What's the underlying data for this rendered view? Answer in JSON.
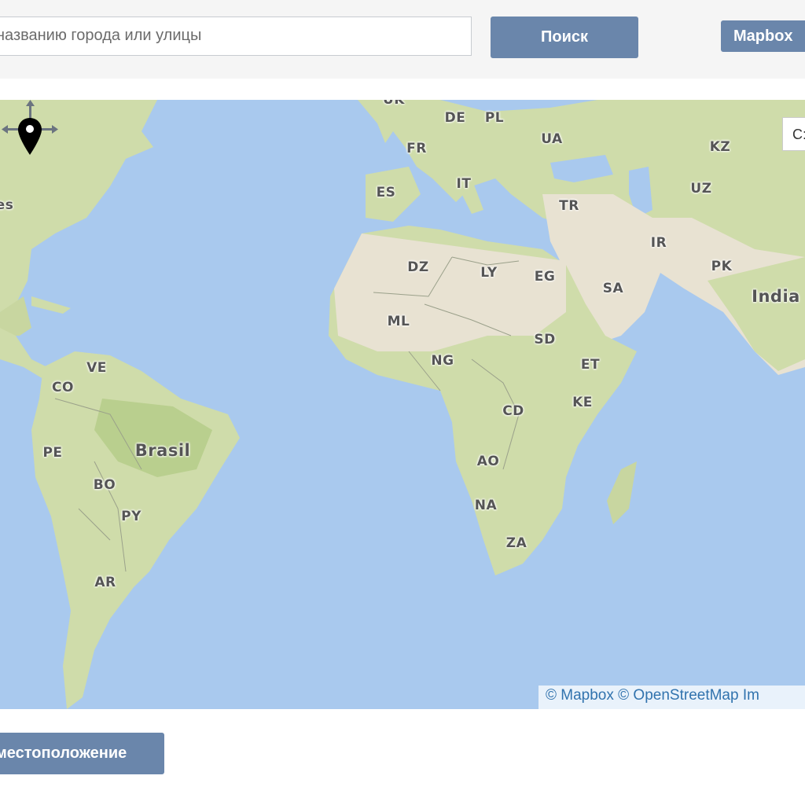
{
  "search": {
    "placeholder": "названию города или улицы",
    "button_label": "Поиск"
  },
  "layer_button_label": "Mapbox",
  "map": {
    "zoom_control_text": "C:",
    "attribution": "© Mapbox © OpenStreetMap Im",
    "labels": [
      {
        "text": "UK",
        "size": "normal"
      },
      {
        "text": "DE",
        "size": "normal"
      },
      {
        "text": "PL",
        "size": "normal"
      },
      {
        "text": "FR",
        "size": "normal"
      },
      {
        "text": "UA",
        "size": "normal"
      },
      {
        "text": "KZ",
        "size": "normal"
      },
      {
        "text": "ES",
        "size": "normal"
      },
      {
        "text": "IT",
        "size": "normal"
      },
      {
        "text": "UZ",
        "size": "normal"
      },
      {
        "text": "es",
        "size": "normal"
      },
      {
        "text": "TR",
        "size": "normal"
      },
      {
        "text": "IR",
        "size": "normal"
      },
      {
        "text": "DZ",
        "size": "normal"
      },
      {
        "text": "LY",
        "size": "normal"
      },
      {
        "text": "EG",
        "size": "normal"
      },
      {
        "text": "PK",
        "size": "normal"
      },
      {
        "text": "SA",
        "size": "normal"
      },
      {
        "text": "India",
        "size": "big"
      },
      {
        "text": "ML",
        "size": "normal"
      },
      {
        "text": "SD",
        "size": "normal"
      },
      {
        "text": "NG",
        "size": "normal"
      },
      {
        "text": "ET",
        "size": "normal"
      },
      {
        "text": "VE",
        "size": "normal"
      },
      {
        "text": "CO",
        "size": "normal"
      },
      {
        "text": "CD",
        "size": "normal"
      },
      {
        "text": "KE",
        "size": "normal"
      },
      {
        "text": "Brasil",
        "size": "big"
      },
      {
        "text": "PE",
        "size": "normal"
      },
      {
        "text": "AO",
        "size": "normal"
      },
      {
        "text": "BO",
        "size": "normal"
      },
      {
        "text": "NA",
        "size": "normal"
      },
      {
        "text": "PY",
        "size": "normal"
      },
      {
        "text": "ZA",
        "size": "normal"
      },
      {
        "text": "AR",
        "size": "normal"
      }
    ],
    "marker_icon": "map-pin-icon"
  },
  "locate_button_label": "местоположение",
  "colors": {
    "water": "#a9c9ee",
    "land": "#cfdcaa",
    "desert": "#e8e2d2",
    "button": "#6a86ab",
    "link": "#3173ae"
  }
}
